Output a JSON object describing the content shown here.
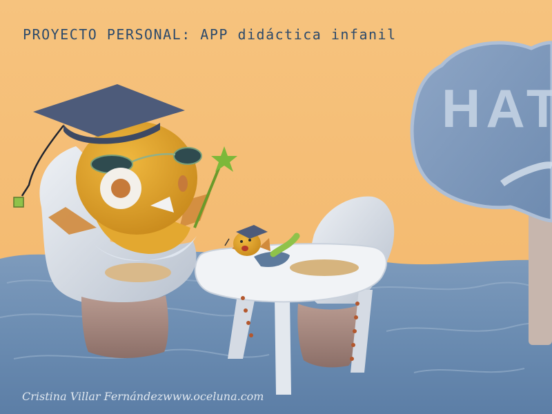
{
  "header": {
    "title": "PROYECTO PERSONAL: APP didáctica infanil"
  },
  "sign": {
    "text": "HAT"
  },
  "footer": {
    "author": "Cristina Villar Fernández",
    "website": "www.oceluna.com"
  },
  "colors": {
    "sky": "#f5c07a",
    "water": "#6f8fb2",
    "bird": "#e0a52a",
    "cap": "#4a5a7a",
    "title_text": "#2c4a6b"
  }
}
